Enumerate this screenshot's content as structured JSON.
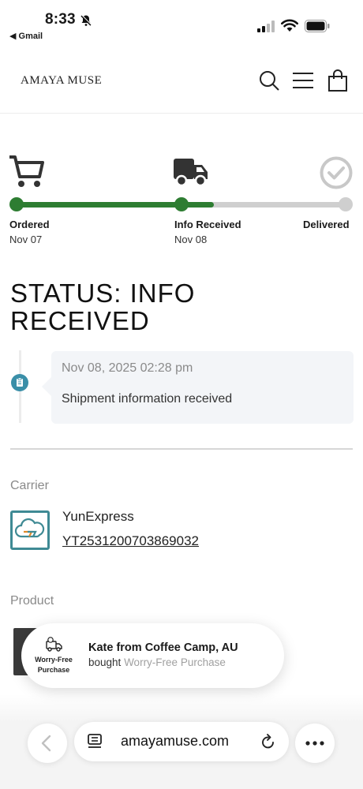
{
  "status_bar": {
    "time": "8:33",
    "back_app": "◀ Gmail"
  },
  "header": {
    "brand": "AMAYA MUSE",
    "icons": [
      "search-icon",
      "menu-icon",
      "bag-icon"
    ]
  },
  "progress": {
    "fraction_complete": 0.6,
    "steps": [
      {
        "label": "Ordered",
        "date": "Nov 07",
        "done": true,
        "icon": "cart-icon"
      },
      {
        "label": "Info Received",
        "date": "Nov 08",
        "done": true,
        "icon": "truck-icon"
      },
      {
        "label": "Delivered",
        "date": "",
        "done": false,
        "icon": "check-circle-icon"
      }
    ]
  },
  "status_title": "STATUS: INFO RECEIVED",
  "timeline": [
    {
      "time": "Nov 08, 2025 02:28 pm",
      "description": "Shipment information received",
      "icon": "clipboard-icon"
    }
  ],
  "carrier": {
    "section_label": "Carrier",
    "name": "YunExpress",
    "tracking_number": "YT2531200703869032"
  },
  "product": {
    "section_label": "Product"
  },
  "popup": {
    "badge_text": "Worry-Free Purchase",
    "name_line": "Kate from Coffee Camp, AU",
    "bought_prefix": "bought",
    "bought_item": "Worry-Free Purchase"
  },
  "browser": {
    "url": "amayamuse.com"
  },
  "colors": {
    "progress_green": "#2e7d32",
    "progress_grey": "#cfcfcf",
    "carrier_teal": "#3f8a94",
    "timeline_icon": "#3a8fa8"
  }
}
